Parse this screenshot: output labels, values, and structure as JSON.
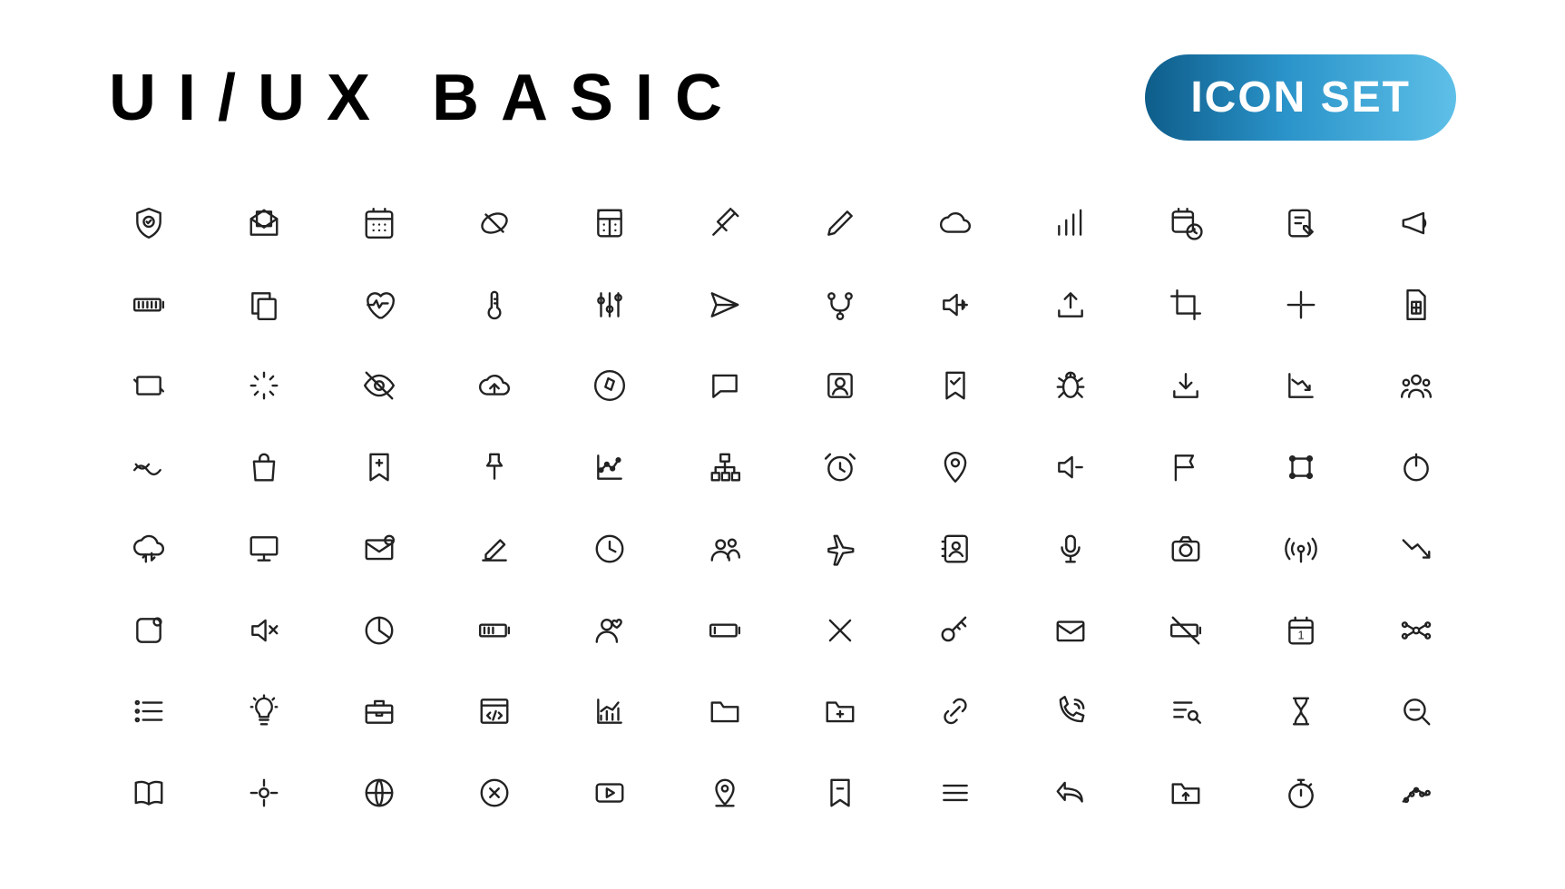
{
  "header": {
    "title": "UI/UX BASIC",
    "badge": "ICON SET"
  },
  "icons": [
    [
      "shield-check",
      "mail-open",
      "calendar-grid",
      "card-cross",
      "calculator",
      "syringe",
      "pencil",
      "cloud",
      "bar-chart",
      "calendar-clock",
      "edit-note",
      "megaphone"
    ],
    [
      "battery-full",
      "copy",
      "heart-pulse",
      "thermometer",
      "sliders",
      "send",
      "branch",
      "volume-up",
      "upload-tray",
      "crop",
      "minimize",
      "sim-card"
    ],
    [
      "rotate",
      "loading",
      "eye-off",
      "cloud-up",
      "compass",
      "chat",
      "user-card",
      "bookmark-check",
      "bug",
      "download-tray",
      "chart-down",
      "group"
    ],
    [
      "wave",
      "shopping-bag",
      "bookmark-add",
      "pin",
      "line-chart-dots",
      "sitemap",
      "alarm",
      "location-pin",
      "volume-down",
      "flag",
      "frame",
      "power"
    ],
    [
      "cloud-sync",
      "monitor",
      "mail-new",
      "edit-line",
      "clock",
      "users",
      "airplane",
      "contacts",
      "microphone",
      "camera",
      "broadcast",
      "trend-down"
    ],
    [
      "square-notif",
      "volume-mute",
      "pie-chart",
      "battery-mid",
      "user-heart",
      "battery-low",
      "close",
      "key",
      "envelope",
      "battery-off",
      "calendar-day",
      "share-nodes"
    ],
    [
      "list",
      "lightbulb",
      "briefcase",
      "code-window",
      "bar-trend",
      "folder",
      "folder-add",
      "link",
      "phone-ring",
      "list-search",
      "hourglass",
      "zoom-out"
    ],
    [
      "book",
      "target",
      "globe",
      "close-circle",
      "video",
      "map-pin",
      "bookmark-remove",
      "menu",
      "reply",
      "folder-up",
      "stopwatch",
      "chart-scatter"
    ]
  ]
}
